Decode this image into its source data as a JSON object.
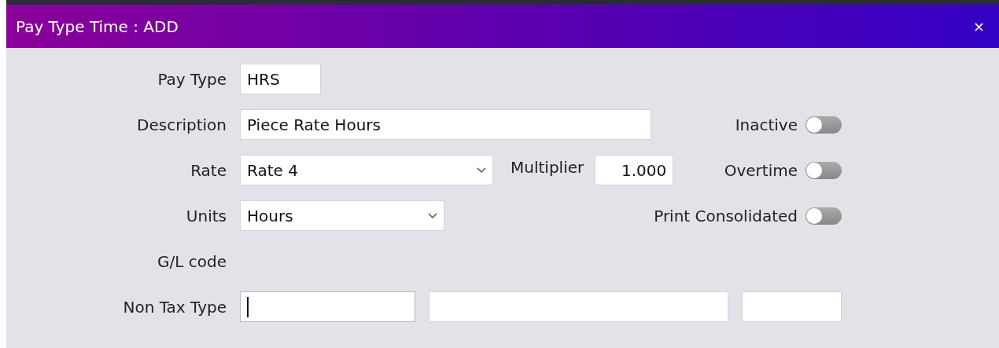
{
  "window": {
    "title": "Pay Type Time : ADD",
    "close": "×"
  },
  "form": {
    "pay_type": {
      "label": "Pay Type",
      "value": "HRS"
    },
    "description": {
      "label": "Description",
      "value": "Piece Rate Hours"
    },
    "rate": {
      "label": "Rate",
      "value": "Rate 4"
    },
    "multiplier": {
      "label": "Multiplier",
      "value": "1.000"
    },
    "units": {
      "label": "Units",
      "value": "Hours"
    },
    "gl_code": {
      "label": "G/L code"
    },
    "non_tax_type": {
      "label": "Non Tax Type",
      "fields": [
        {
          "focused": true
        },
        {
          "focused": false
        },
        {
          "focused": false
        }
      ]
    },
    "toggles": [
      {
        "label": "Inactive",
        "on": false
      },
      {
        "label": "Overtime",
        "on": false
      },
      {
        "label": "Print Consolidated",
        "on": false
      }
    ]
  }
}
